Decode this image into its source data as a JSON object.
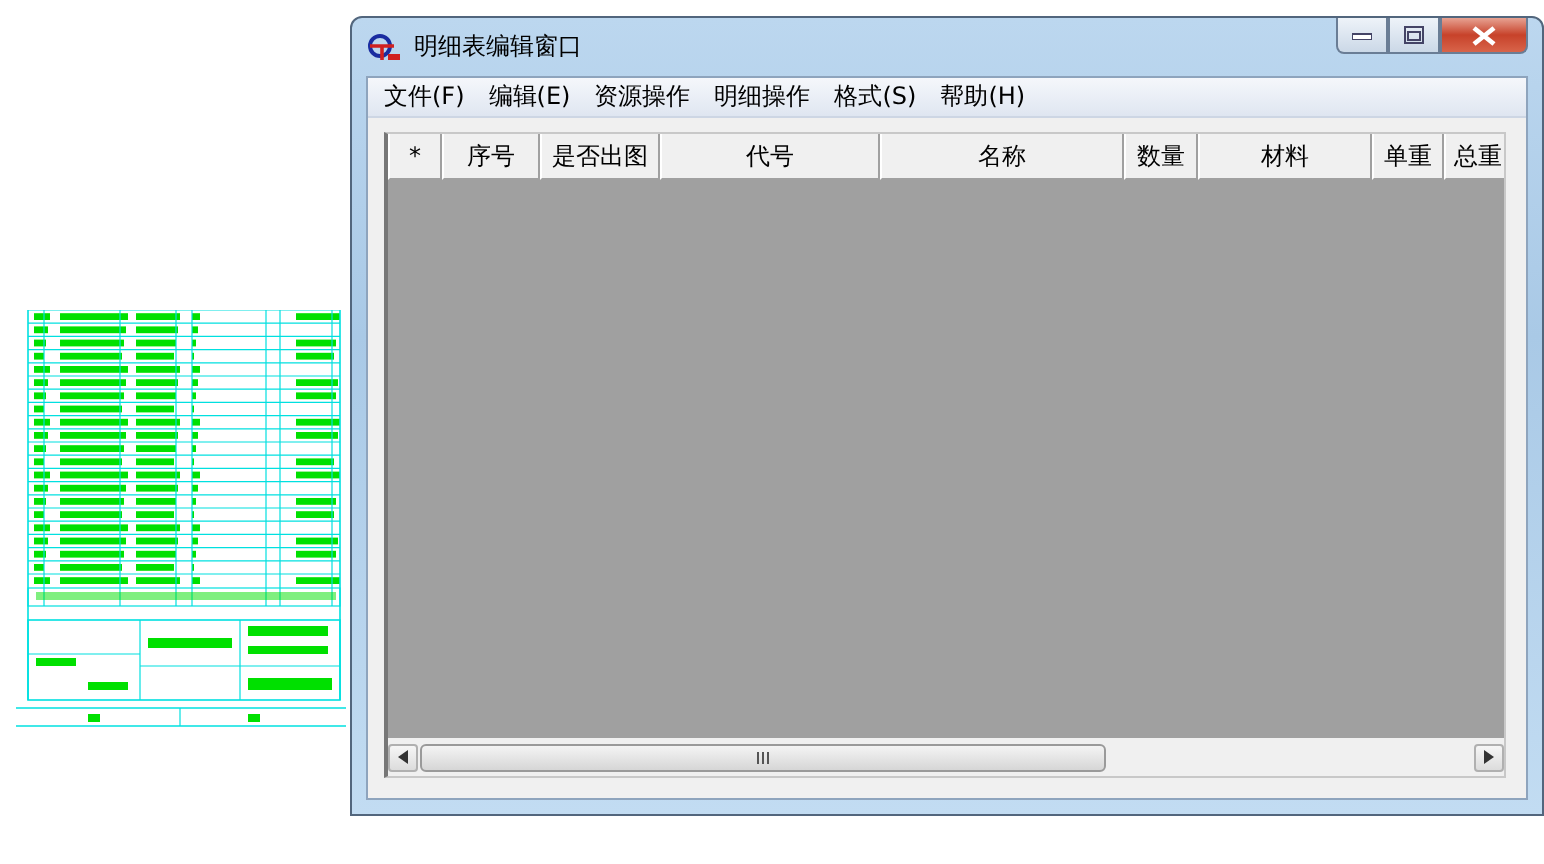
{
  "window": {
    "title": "明细表编辑窗口"
  },
  "menu": [
    "文件(F)",
    "编辑(E)",
    "资源操作",
    "明细操作",
    "格式(S)",
    "帮助(H)"
  ],
  "table": {
    "columns": [
      {
        "label": "*"
      },
      {
        "label": "序号"
      },
      {
        "label": "是否出图"
      },
      {
        "label": "代号"
      },
      {
        "label": "名称"
      },
      {
        "label": "数量"
      },
      {
        "label": "材料"
      },
      {
        "label": "单重"
      },
      {
        "label": "总重"
      }
    ]
  }
}
